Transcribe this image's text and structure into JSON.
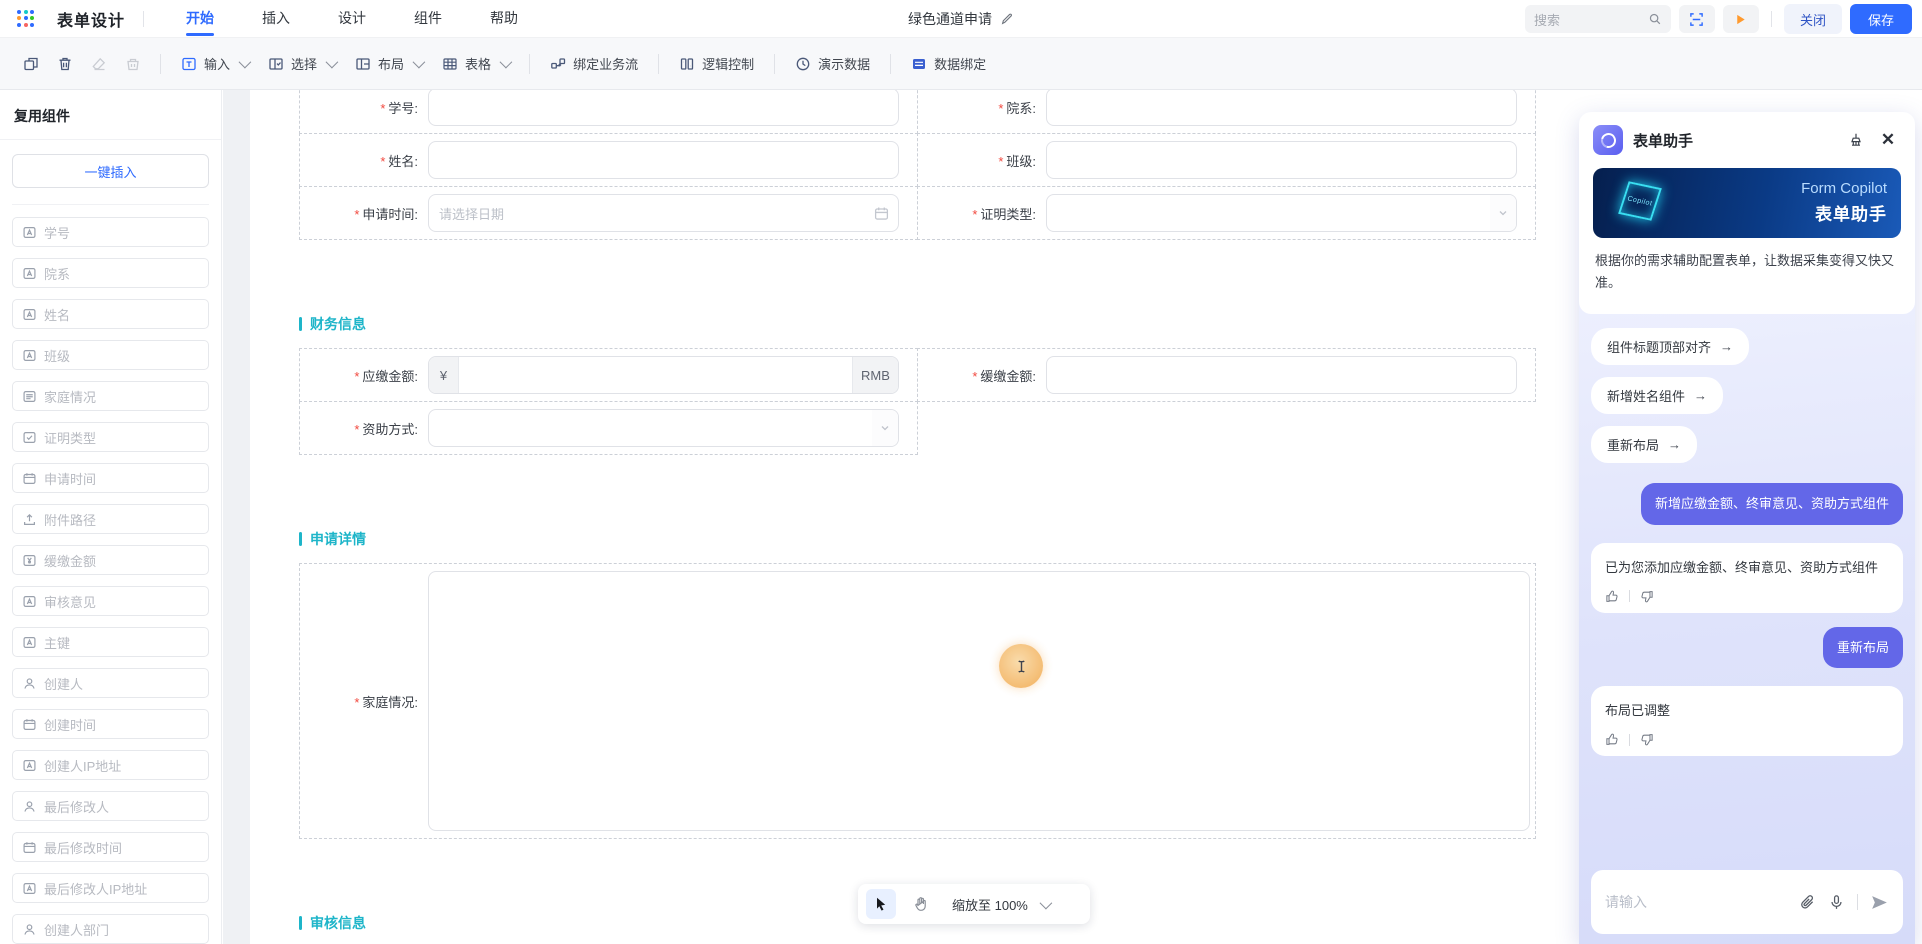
{
  "header": {
    "app_title": "表单设计",
    "menus": [
      "开始",
      "插入",
      "设计",
      "组件",
      "帮助"
    ],
    "active_menu": "开始",
    "doc_title": "绿色通道申请",
    "search_placeholder": "搜索",
    "close_label": "关闭",
    "save_label": "保存"
  },
  "toolbar": {
    "input_label": "输入",
    "select_label": "选择",
    "layout_label": "布局",
    "table_label": "表格",
    "bind_flow_label": "绑定业务流",
    "logic_label": "逻辑控制",
    "demo_label": "演示数据",
    "data_bind_label": "数据绑定"
  },
  "sidebar": {
    "title": "复用组件",
    "insert_button": "一键插入",
    "items": [
      {
        "label": "学号",
        "icon": "text"
      },
      {
        "label": "院系",
        "icon": "text"
      },
      {
        "label": "姓名",
        "icon": "text"
      },
      {
        "label": "班级",
        "icon": "text"
      },
      {
        "label": "家庭情况",
        "icon": "textarea"
      },
      {
        "label": "证明类型",
        "icon": "select"
      },
      {
        "label": "申请时间",
        "icon": "date"
      },
      {
        "label": "附件路径",
        "icon": "upload"
      },
      {
        "label": "缓缴金额",
        "icon": "money"
      },
      {
        "label": "审核意见",
        "icon": "text"
      },
      {
        "label": "主键",
        "icon": "text"
      },
      {
        "label": "创建人",
        "icon": "user"
      },
      {
        "label": "创建时间",
        "icon": "date"
      },
      {
        "label": "创建人IP地址",
        "icon": "text"
      },
      {
        "label": "最后修改人",
        "icon": "user"
      },
      {
        "label": "最后修改时间",
        "icon": "date"
      },
      {
        "label": "最后修改人IP地址",
        "icon": "text"
      },
      {
        "label": "创建人部门",
        "icon": "user"
      }
    ]
  },
  "form": {
    "rows": [
      {
        "kind": "pair",
        "left": {
          "label": "学号",
          "required": true,
          "control": "text"
        },
        "right": {
          "label": "院系",
          "required": true,
          "control": "text"
        }
      },
      {
        "kind": "pair",
        "left": {
          "label": "姓名",
          "required": true,
          "control": "text"
        },
        "right": {
          "label": "班级",
          "required": true,
          "control": "text"
        }
      },
      {
        "kind": "pair",
        "left": {
          "label": "申请时间",
          "required": true,
          "control": "date",
          "placeholder": "请选择日期"
        },
        "right": {
          "label": "证明类型",
          "required": true,
          "control": "select"
        }
      },
      {
        "kind": "section",
        "title": "财务信息"
      },
      {
        "kind": "pair",
        "left": {
          "label": "应缴金额",
          "required": true,
          "control": "money",
          "prefix": "¥",
          "suffix": "RMB"
        },
        "right": {
          "label": "缓缴金额",
          "required": true,
          "control": "text"
        }
      },
      {
        "kind": "pair",
        "left": {
          "label": "资助方式",
          "required": true,
          "control": "select"
        },
        "right": null
      },
      {
        "kind": "section",
        "title": "申请详情"
      },
      {
        "kind": "full",
        "field": {
          "label": "家庭情况",
          "required": true,
          "control": "textarea"
        }
      },
      {
        "kind": "section",
        "title": "审核信息"
      }
    ]
  },
  "zoombar": {
    "zoom_label": "缩放至 100%"
  },
  "assistant": {
    "title": "表单助手",
    "banner_title": "Form Copilot",
    "banner_subtitle": "表单助手",
    "banner_cube_text": "Copilot",
    "intro": "根据你的需求辅助配置表单，让数据采集变得又快又准。",
    "suggestions": [
      "组件标题顶部对齐",
      "新增姓名组件",
      "重新布局"
    ],
    "messages": [
      {
        "role": "user",
        "text": "新增应缴金额、终审意见、资助方式组件"
      },
      {
        "role": "assistant",
        "text": "已为您添加应缴金额、终审意见、资助方式组件"
      },
      {
        "role": "user",
        "text": "重新布局"
      },
      {
        "role": "assistant",
        "text": "布局已调整"
      }
    ],
    "input_placeholder": "请输入",
    "accent_user_bubble": "#6367e8",
    "accent_section": "#1eb5c9",
    "accent_primary": "#2f6bff"
  }
}
